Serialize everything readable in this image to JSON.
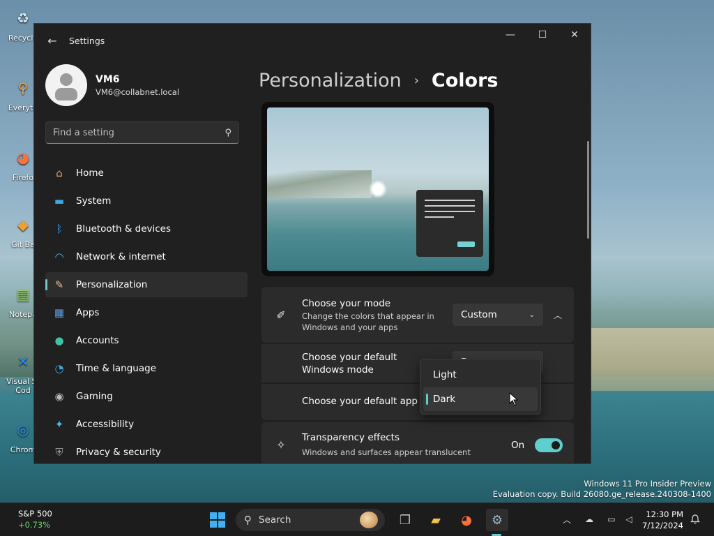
{
  "desktop": {
    "icons": [
      {
        "label": "Recycle",
        "glyph": "♻",
        "color": "#cfe8f7"
      },
      {
        "label": "Everyth",
        "glyph": "🔍",
        "color": "#f7a13a"
      },
      {
        "label": "Firefo",
        "glyph": "🦊",
        "color": "#ff7139"
      },
      {
        "label": "Git Ba",
        "glyph": "◆",
        "color": "#f0a030"
      },
      {
        "label": "Notepa",
        "glyph": "📝",
        "color": "#9bd36b"
      },
      {
        "label": "Visual St Cod",
        "glyph": "⟩",
        "color": "#2a8ce6"
      },
      {
        "label": "Chrom",
        "glyph": "◎",
        "color": "#2b8ce6"
      }
    ],
    "watermark": {
      "line1": "Windows 11 Pro Insider Preview",
      "line2": "Evaluation copy. Build 26080.ge_release.240308-1400"
    }
  },
  "window": {
    "title": "Settings",
    "controls": {
      "minimize": "—",
      "maximize": "☐",
      "close": "✕"
    }
  },
  "profile": {
    "name": "VM6",
    "email": "VM6@collabnet.local"
  },
  "search": {
    "placeholder": "Find a setting"
  },
  "nav": {
    "items": [
      {
        "label": "Home",
        "icon": "home-icon",
        "glyph": "⌂",
        "color": "#f0a06a"
      },
      {
        "label": "System",
        "icon": "monitor-icon",
        "glyph": "▬",
        "color": "#38a8e6"
      },
      {
        "label": "Bluetooth & devices",
        "icon": "bluetooth-icon",
        "glyph": "ᛒ",
        "color": "#3aa0f0"
      },
      {
        "label": "Network & internet",
        "icon": "wifi-icon",
        "glyph": "◠",
        "color": "#49b8f5"
      },
      {
        "label": "Personalization",
        "icon": "brush-icon",
        "glyph": "✎",
        "color": "#e9b48a"
      },
      {
        "label": "Apps",
        "icon": "apps-icon",
        "glyph": "▦",
        "color": "#5aa0e8"
      },
      {
        "label": "Accounts",
        "icon": "person-icon",
        "glyph": "●",
        "color": "#3ec4a4"
      },
      {
        "label": "Time & language",
        "icon": "globe-icon",
        "glyph": "◔",
        "color": "#3aa6e8"
      },
      {
        "label": "Gaming",
        "icon": "gamepad-icon",
        "glyph": "◉",
        "color": "#b8b8b8"
      },
      {
        "label": "Accessibility",
        "icon": "accessibility-icon",
        "glyph": "✦",
        "color": "#4ab6f0"
      },
      {
        "label": "Privacy & security",
        "icon": "shield-icon",
        "glyph": "⛨",
        "color": "#9a9a9a"
      }
    ],
    "active_index": 4
  },
  "breadcrumb": {
    "parent": "Personalization",
    "separator": "›",
    "current": "Colors"
  },
  "mode_card": {
    "title": "Choose your mode",
    "description": "Change the colors that appear in Windows and your apps",
    "value": "Custom",
    "expanded": true
  },
  "windows_mode_row": {
    "title": "Choose your default Windows mode",
    "value_partial": "D"
  },
  "app_mode_row": {
    "title": "Choose your default app mode"
  },
  "dropdown": {
    "options": [
      "Light",
      "Dark"
    ],
    "selected": "Dark"
  },
  "transparency_card": {
    "title": "Transparency effects",
    "description": "Windows and surfaces appear translucent",
    "state_label": "On",
    "enabled": true
  },
  "accent_color": "#60cdcf",
  "taskbar": {
    "widget": {
      "name": "S&P 500",
      "change": "+0.73%"
    },
    "search_label": "Search",
    "clock": {
      "time": "12:30 PM",
      "date": "7/12/2024"
    }
  }
}
